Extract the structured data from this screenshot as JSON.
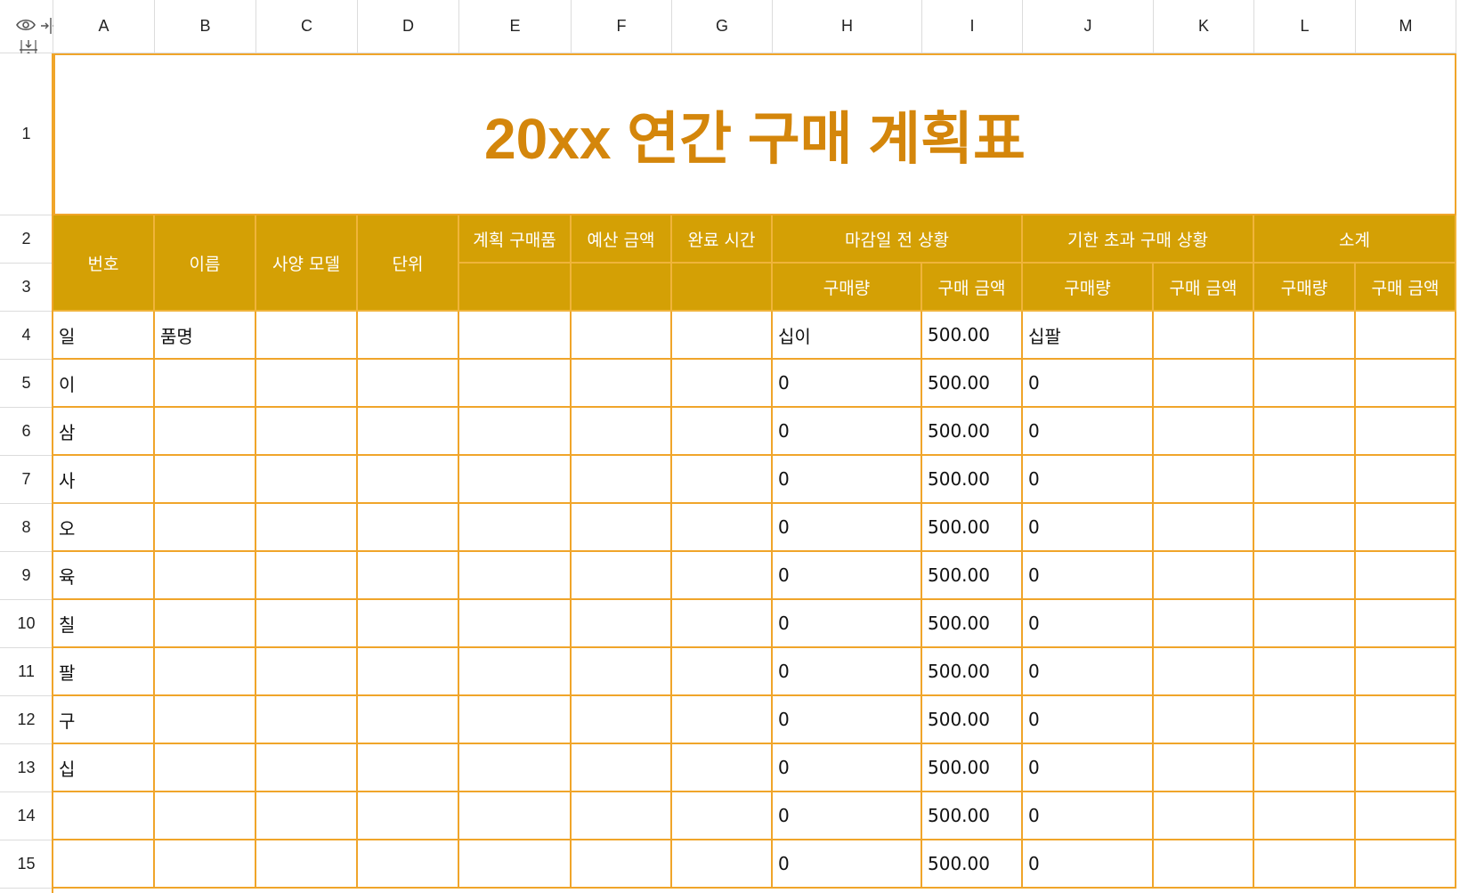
{
  "title": "20xx 연간 구매 계획표",
  "columns": [
    "A",
    "B",
    "C",
    "D",
    "E",
    "F",
    "G",
    "H",
    "I",
    "J",
    "K",
    "L",
    "M"
  ],
  "rows": [
    "1",
    "2",
    "3",
    "4",
    "5",
    "6",
    "7",
    "8",
    "9",
    "10",
    "11",
    "12",
    "13",
    "14",
    "15"
  ],
  "header": {
    "number": "번호",
    "name": "이름",
    "spec_model": "사양 모델",
    "unit": "단위",
    "planned_item": "계획 구매품",
    "budget": "예산 금액",
    "completion_time": "완료 시간",
    "before_deadline": "마감일 전 상황",
    "overdue": "기한 초과 구매 상황",
    "subtotal": "소계",
    "qty_h": "구매량",
    "amt_i": "구매 금액",
    "qty_j": "구매량",
    "amt_k": "구매 금액",
    "qty_l": "구매량",
    "amt_m": "구매 금액"
  },
  "data_rows": [
    {
      "a": "일",
      "b": "품명",
      "h": "십이",
      "i": "500.00",
      "j": "십팔"
    },
    {
      "a": "이",
      "b": "",
      "h": "0",
      "i": "500.00",
      "j": "0"
    },
    {
      "a": "삼",
      "b": "",
      "h": "0",
      "i": "500.00",
      "j": "0"
    },
    {
      "a": "사",
      "b": "",
      "h": "0",
      "i": "500.00",
      "j": "0"
    },
    {
      "a": "오",
      "b": "",
      "h": "0",
      "i": "500.00",
      "j": "0"
    },
    {
      "a": "육",
      "b": "",
      "h": "0",
      "i": "500.00",
      "j": "0"
    },
    {
      "a": "칠",
      "b": "",
      "h": "0",
      "i": "500.00",
      "j": "0"
    },
    {
      "a": "팔",
      "b": "",
      "h": "0",
      "i": "500.00",
      "j": "0"
    },
    {
      "a": "구",
      "b": "",
      "h": "0",
      "i": "500.00",
      "j": "0"
    },
    {
      "a": "십",
      "b": "",
      "h": "0",
      "i": "500.00",
      "j": "0"
    },
    {
      "a": "",
      "b": "",
      "h": "0",
      "i": "500.00",
      "j": "0"
    },
    {
      "a": "",
      "b": "",
      "h": "0",
      "i": "500.00",
      "j": "0"
    }
  ],
  "icons": {
    "corner": [
      "eye-icon",
      "collapse-columns-icon",
      "collapse-rows-icon"
    ]
  },
  "colors": {
    "accent": "#d4a005",
    "grid": "#f0a52a",
    "title": "#d4860b"
  }
}
